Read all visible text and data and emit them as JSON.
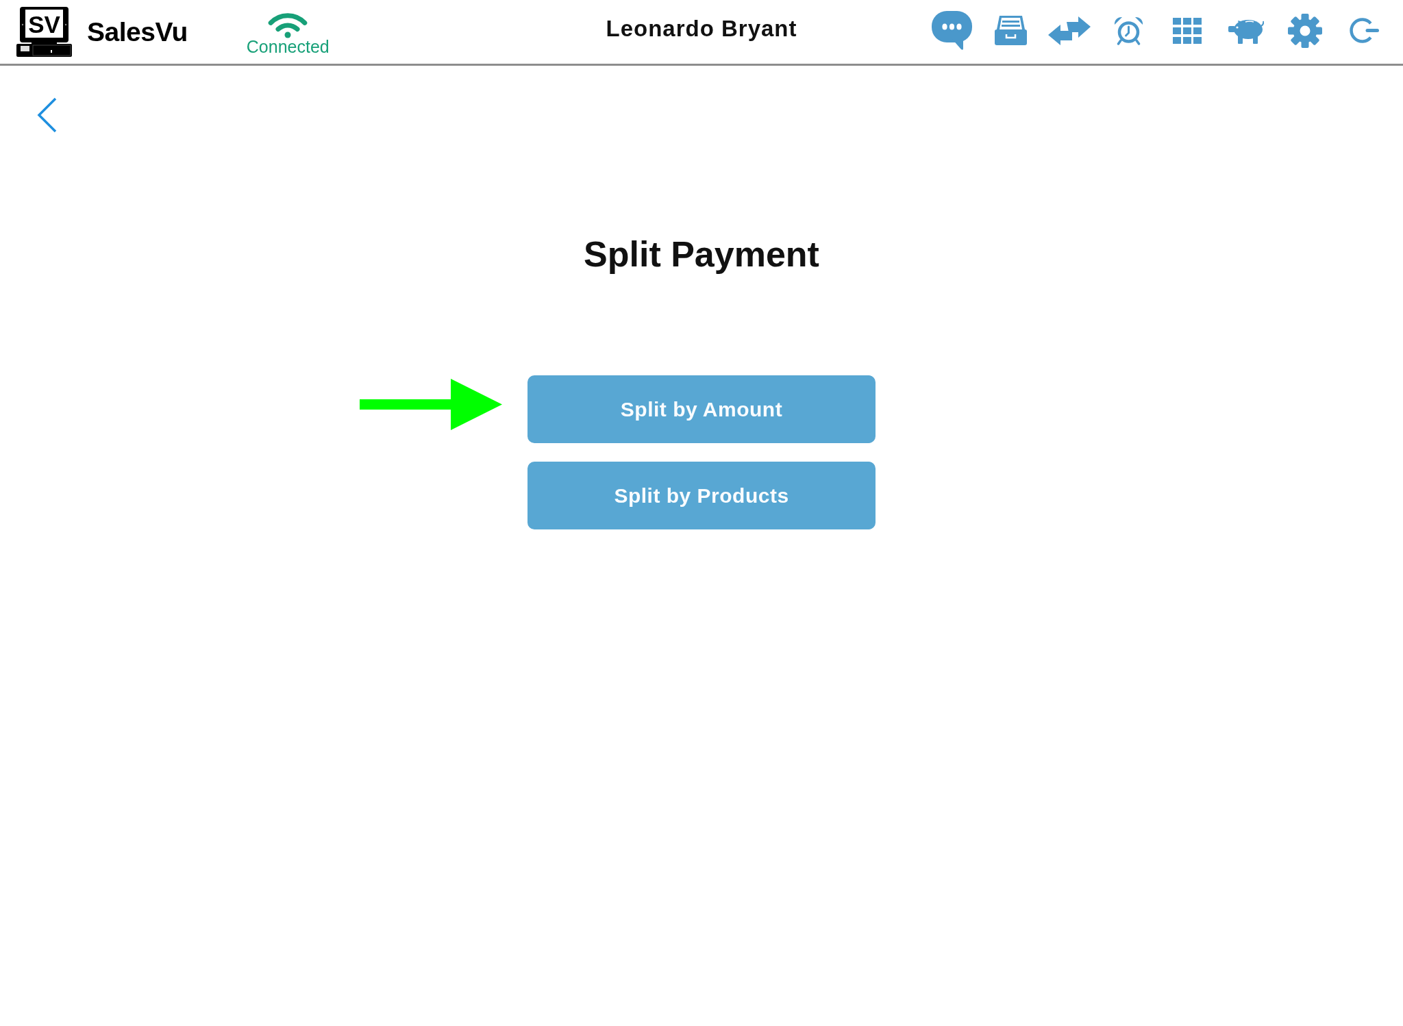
{
  "header": {
    "logo_mark": "SV",
    "brand": "SalesVu",
    "connection": {
      "status": "Connected",
      "connected": true
    },
    "user_name": "Leonardo Bryant"
  },
  "page": {
    "title": "Split Payment",
    "options": [
      {
        "label": "Split by Amount",
        "pointed": true
      },
      {
        "label": "Split by Products",
        "pointed": false
      }
    ]
  }
}
